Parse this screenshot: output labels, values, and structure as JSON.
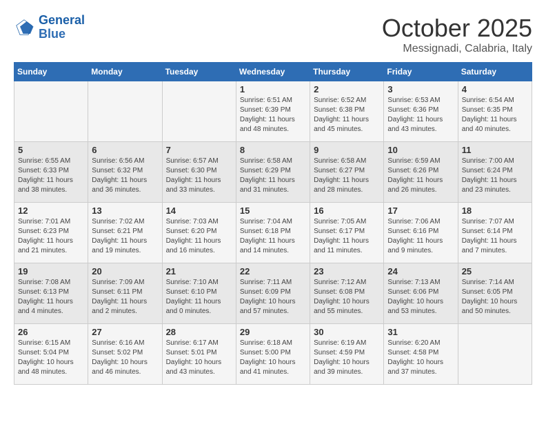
{
  "logo": {
    "line1": "General",
    "line2": "Blue"
  },
  "title": "October 2025",
  "subtitle": "Messignadi, Calabria, Italy",
  "weekdays": [
    "Sunday",
    "Monday",
    "Tuesday",
    "Wednesday",
    "Thursday",
    "Friday",
    "Saturday"
  ],
  "weeks": [
    [
      {
        "day": "",
        "info": ""
      },
      {
        "day": "",
        "info": ""
      },
      {
        "day": "",
        "info": ""
      },
      {
        "day": "1",
        "info": "Sunrise: 6:51 AM\nSunset: 6:39 PM\nDaylight: 11 hours\nand 48 minutes."
      },
      {
        "day": "2",
        "info": "Sunrise: 6:52 AM\nSunset: 6:38 PM\nDaylight: 11 hours\nand 45 minutes."
      },
      {
        "day": "3",
        "info": "Sunrise: 6:53 AM\nSunset: 6:36 PM\nDaylight: 11 hours\nand 43 minutes."
      },
      {
        "day": "4",
        "info": "Sunrise: 6:54 AM\nSunset: 6:35 PM\nDaylight: 11 hours\nand 40 minutes."
      }
    ],
    [
      {
        "day": "5",
        "info": "Sunrise: 6:55 AM\nSunset: 6:33 PM\nDaylight: 11 hours\nand 38 minutes."
      },
      {
        "day": "6",
        "info": "Sunrise: 6:56 AM\nSunset: 6:32 PM\nDaylight: 11 hours\nand 36 minutes."
      },
      {
        "day": "7",
        "info": "Sunrise: 6:57 AM\nSunset: 6:30 PM\nDaylight: 11 hours\nand 33 minutes."
      },
      {
        "day": "8",
        "info": "Sunrise: 6:58 AM\nSunset: 6:29 PM\nDaylight: 11 hours\nand 31 minutes."
      },
      {
        "day": "9",
        "info": "Sunrise: 6:58 AM\nSunset: 6:27 PM\nDaylight: 11 hours\nand 28 minutes."
      },
      {
        "day": "10",
        "info": "Sunrise: 6:59 AM\nSunset: 6:26 PM\nDaylight: 11 hours\nand 26 minutes."
      },
      {
        "day": "11",
        "info": "Sunrise: 7:00 AM\nSunset: 6:24 PM\nDaylight: 11 hours\nand 23 minutes."
      }
    ],
    [
      {
        "day": "12",
        "info": "Sunrise: 7:01 AM\nSunset: 6:23 PM\nDaylight: 11 hours\nand 21 minutes."
      },
      {
        "day": "13",
        "info": "Sunrise: 7:02 AM\nSunset: 6:21 PM\nDaylight: 11 hours\nand 19 minutes."
      },
      {
        "day": "14",
        "info": "Sunrise: 7:03 AM\nSunset: 6:20 PM\nDaylight: 11 hours\nand 16 minutes."
      },
      {
        "day": "15",
        "info": "Sunrise: 7:04 AM\nSunset: 6:18 PM\nDaylight: 11 hours\nand 14 minutes."
      },
      {
        "day": "16",
        "info": "Sunrise: 7:05 AM\nSunset: 6:17 PM\nDaylight: 11 hours\nand 11 minutes."
      },
      {
        "day": "17",
        "info": "Sunrise: 7:06 AM\nSunset: 6:16 PM\nDaylight: 11 hours\nand 9 minutes."
      },
      {
        "day": "18",
        "info": "Sunrise: 7:07 AM\nSunset: 6:14 PM\nDaylight: 11 hours\nand 7 minutes."
      }
    ],
    [
      {
        "day": "19",
        "info": "Sunrise: 7:08 AM\nSunset: 6:13 PM\nDaylight: 11 hours\nand 4 minutes."
      },
      {
        "day": "20",
        "info": "Sunrise: 7:09 AM\nSunset: 6:11 PM\nDaylight: 11 hours\nand 2 minutes."
      },
      {
        "day": "21",
        "info": "Sunrise: 7:10 AM\nSunset: 6:10 PM\nDaylight: 11 hours\nand 0 minutes."
      },
      {
        "day": "22",
        "info": "Sunrise: 7:11 AM\nSunset: 6:09 PM\nDaylight: 10 hours\nand 57 minutes."
      },
      {
        "day": "23",
        "info": "Sunrise: 7:12 AM\nSunset: 6:08 PM\nDaylight: 10 hours\nand 55 minutes."
      },
      {
        "day": "24",
        "info": "Sunrise: 7:13 AM\nSunset: 6:06 PM\nDaylight: 10 hours\nand 53 minutes."
      },
      {
        "day": "25",
        "info": "Sunrise: 7:14 AM\nSunset: 6:05 PM\nDaylight: 10 hours\nand 50 minutes."
      }
    ],
    [
      {
        "day": "26",
        "info": "Sunrise: 6:15 AM\nSunset: 5:04 PM\nDaylight: 10 hours\nand 48 minutes."
      },
      {
        "day": "27",
        "info": "Sunrise: 6:16 AM\nSunset: 5:02 PM\nDaylight: 10 hours\nand 46 minutes."
      },
      {
        "day": "28",
        "info": "Sunrise: 6:17 AM\nSunset: 5:01 PM\nDaylight: 10 hours\nand 43 minutes."
      },
      {
        "day": "29",
        "info": "Sunrise: 6:18 AM\nSunset: 5:00 PM\nDaylight: 10 hours\nand 41 minutes."
      },
      {
        "day": "30",
        "info": "Sunrise: 6:19 AM\nSunset: 4:59 PM\nDaylight: 10 hours\nand 39 minutes."
      },
      {
        "day": "31",
        "info": "Sunrise: 6:20 AM\nSunset: 4:58 PM\nDaylight: 10 hours\nand 37 minutes."
      },
      {
        "day": "",
        "info": ""
      }
    ]
  ]
}
